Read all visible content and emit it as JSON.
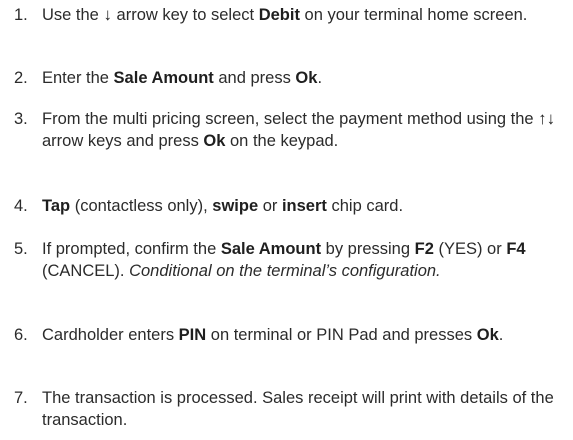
{
  "steps": [
    {
      "number": "1.",
      "parts": [
        {
          "t": "Use the ",
          "s": "normal"
        },
        {
          "t": "↓",
          "s": "arrow"
        },
        {
          "t": " arrow key to select ",
          "s": "normal"
        },
        {
          "t": "Debit",
          "s": "bold"
        },
        {
          "t": " on your terminal home screen.",
          "s": "normal"
        }
      ]
    },
    {
      "number": "2.",
      "parts": [
        {
          "t": "Enter the ",
          "s": "normal"
        },
        {
          "t": "Sale Amount",
          "s": "bold"
        },
        {
          "t": " and press ",
          "s": "normal"
        },
        {
          "t": "Ok",
          "s": "bold"
        },
        {
          "t": ".",
          "s": "normal"
        }
      ]
    },
    {
      "number": "3.",
      "parts": [
        {
          "t": "From the multi pricing screen, select the payment method using the ",
          "s": "normal"
        },
        {
          "t": "↑↓",
          "s": "arrow"
        },
        {
          "t": " arrow keys and press ",
          "s": "normal"
        },
        {
          "t": "Ok",
          "s": "bold"
        },
        {
          "t": " on the keypad.",
          "s": "normal"
        }
      ]
    },
    {
      "number": "4.",
      "parts": [
        {
          "t": "Tap",
          "s": "bold"
        },
        {
          "t": " (contactless only), ",
          "s": "normal"
        },
        {
          "t": "swipe",
          "s": "bold"
        },
        {
          "t": " or ",
          "s": "normal"
        },
        {
          "t": "insert",
          "s": "bold"
        },
        {
          "t": " chip card.",
          "s": "normal"
        }
      ]
    },
    {
      "number": "5.",
      "parts": [
        {
          "t": "If prompted, confirm the ",
          "s": "normal"
        },
        {
          "t": "Sale Amount",
          "s": "bold"
        },
        {
          "t": " by pressing ",
          "s": "normal"
        },
        {
          "t": "F2",
          "s": "bold"
        },
        {
          "t": " (YES) or ",
          "s": "normal"
        },
        {
          "t": "F4",
          "s": "bold"
        },
        {
          "t": " (CANCEL). ",
          "s": "normal"
        },
        {
          "t": "Conditional on the terminal’s configuration.",
          "s": "italic"
        }
      ]
    },
    {
      "number": "6.",
      "parts": [
        {
          "t": "Cardholder enters ",
          "s": "normal"
        },
        {
          "t": "PIN",
          "s": "bold"
        },
        {
          "t": " on terminal or PIN Pad and presses ",
          "s": "normal"
        },
        {
          "t": "Ok",
          "s": "bold"
        },
        {
          "t": ".",
          "s": "normal"
        }
      ]
    },
    {
      "number": "7.",
      "parts": [
        {
          "t": "The transaction is processed. Sales receipt will print with details of the transaction.",
          "s": "normal"
        }
      ]
    }
  ]
}
